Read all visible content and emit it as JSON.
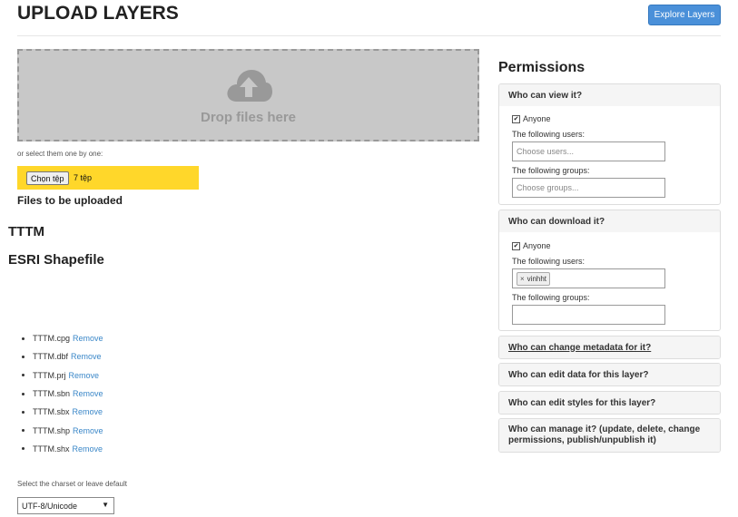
{
  "header": {
    "title": "UPLOAD LAYERS",
    "explore_button": "Explore Layers"
  },
  "upload": {
    "drop_text": "Drop files here",
    "select_note": "or select them one by one:",
    "choose_button": "Chọn tệp",
    "file_count": "7 tệp",
    "files_title": "Files to be uploaded",
    "layer_name": "TTTM",
    "layer_type": "ESRI Shapefile",
    "remove_label": "Remove",
    "files": [
      "TTTM.cpg",
      "TTTM.dbf",
      "TTTM.prj",
      "TTTM.sbn",
      "TTTM.sbx",
      "TTTM.shp",
      "TTTM.shx"
    ],
    "charset_label": "Select the charset or leave default",
    "charset_value": "UTF-8/Unicode"
  },
  "permissions": {
    "title": "Permissions",
    "view": {
      "title": "Who can view it?",
      "anyone": "Anyone",
      "users_label": "The following users:",
      "users_placeholder": "Choose users...",
      "groups_label": "The following groups:",
      "groups_placeholder": "Choose groups..."
    },
    "download": {
      "title": "Who can download it?",
      "anyone": "Anyone",
      "users_label": "The following users:",
      "user_tag": "vinhht",
      "groups_label": "The following groups:"
    },
    "change_metadata": "Who can change metadata for it?",
    "edit_data": "Who can edit data for this layer?",
    "edit_styles": "Who can edit styles for this layer?",
    "manage": "Who can manage it? (update, delete, change permissions, publish/unpublish it)"
  },
  "colors": {
    "accent": "#4a90d9",
    "file_bar": "#ffd72a",
    "link": "#3a87c8",
    "dropzone": "#c8c8c8"
  },
  "icons": {
    "upload": "cloud-upload-icon",
    "tag_remove": "close-icon",
    "select_arrow": "caret-down-icon"
  }
}
